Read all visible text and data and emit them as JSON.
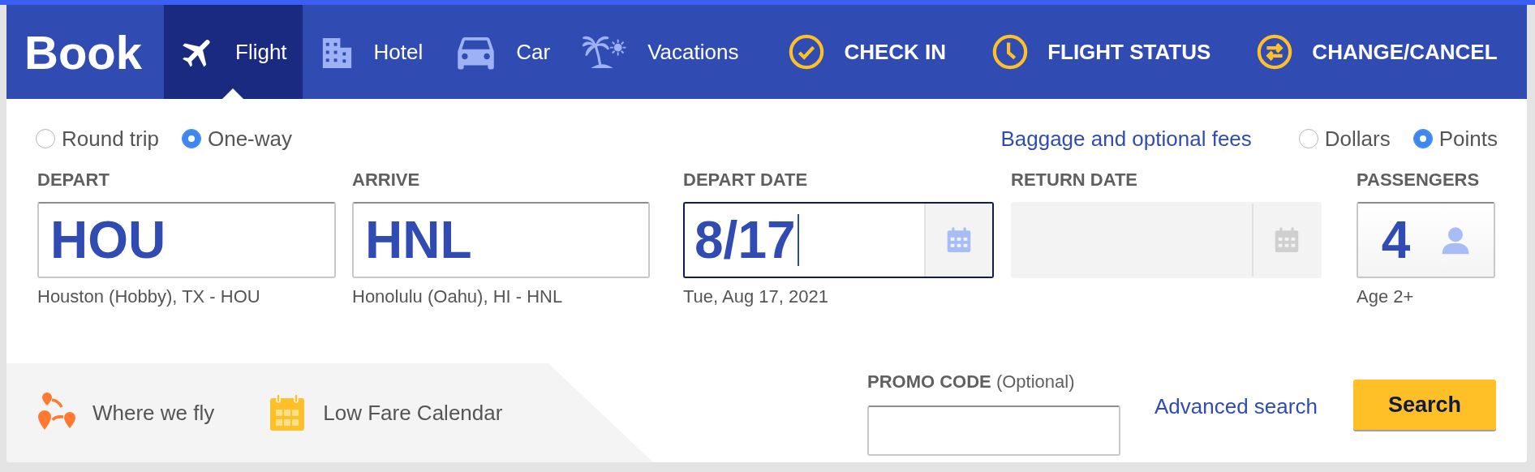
{
  "header": {
    "title": "Book",
    "tabs": [
      {
        "label": "Flight",
        "selected": true
      },
      {
        "label": "Hotel",
        "selected": false
      },
      {
        "label": "Car",
        "selected": false
      },
      {
        "label": "Vacations",
        "selected": false
      }
    ],
    "actions": [
      {
        "label": "CHECK IN"
      },
      {
        "label": "FLIGHT STATUS"
      },
      {
        "label": "CHANGE/CANCEL"
      }
    ]
  },
  "trip_type": [
    {
      "label": "Round trip",
      "selected": false
    },
    {
      "label": "One-way",
      "selected": true
    }
  ],
  "baggage_link": "Baggage and optional fees",
  "currency": [
    {
      "label": "Dollars",
      "selected": false
    },
    {
      "label": "Points",
      "selected": true
    }
  ],
  "fields": [
    {
      "kind": "airport",
      "label": "DEPART",
      "value": "HOU",
      "hint": "Houston (Hobby), TX - HOU"
    },
    {
      "kind": "airport",
      "label": "ARRIVE",
      "value": "HNL",
      "hint": "Honolulu (Oahu), HI - HNL"
    },
    {
      "kind": "date",
      "label": "DEPART DATE",
      "value": "8/17",
      "hint": "Tue, Aug 17, 2021",
      "focused": true,
      "disabled": false
    },
    {
      "kind": "date",
      "label": "RETURN DATE",
      "focused": false,
      "disabled": true
    },
    {
      "kind": "passengers",
      "label": "PASSENGERS",
      "value": "4",
      "hint": "Age 2+"
    }
  ],
  "quick_links": [
    {
      "label": "Where we fly"
    },
    {
      "label": "Low Fare Calendar"
    }
  ],
  "promo": {
    "label": "**PROMO CODE** (Optional)"
  },
  "advanced_link": "Advanced search",
  "search_button": "Search"
}
